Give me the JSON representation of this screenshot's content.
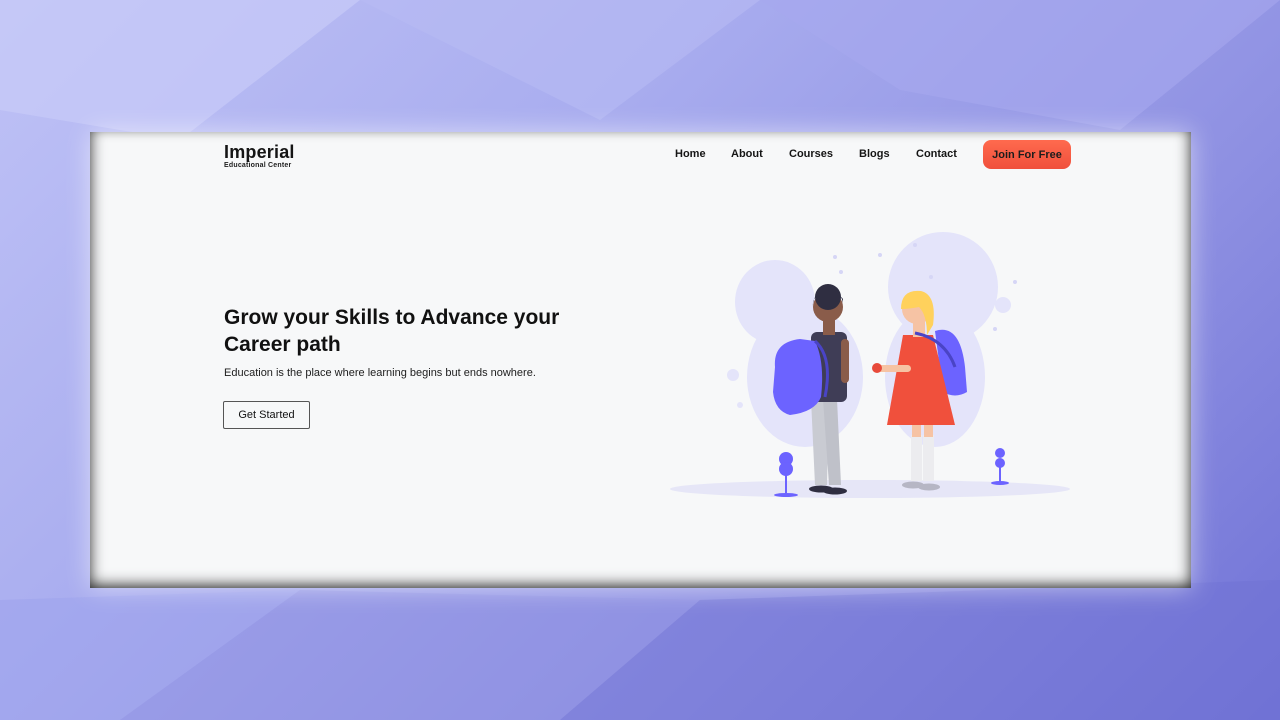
{
  "brand": {
    "name": "Imperial",
    "tagline": "Educational Center"
  },
  "nav": {
    "items": [
      {
        "label": "Home"
      },
      {
        "label": "About"
      },
      {
        "label": "Courses"
      },
      {
        "label": "Blogs"
      },
      {
        "label": "Contact"
      }
    ],
    "cta_label": "Join For Free"
  },
  "hero": {
    "title": "Grow your Skills to Advance your Career path",
    "subtitle": "Education is the place where learning begins but ends nowhere.",
    "button_label": "Get Started"
  },
  "colors": {
    "accent": "#f0503c",
    "illustration_purple": "#6c63ff",
    "card_background": "#f7f8f9"
  },
  "icons": {
    "illustration": "students-with-backpacks-illustration"
  }
}
